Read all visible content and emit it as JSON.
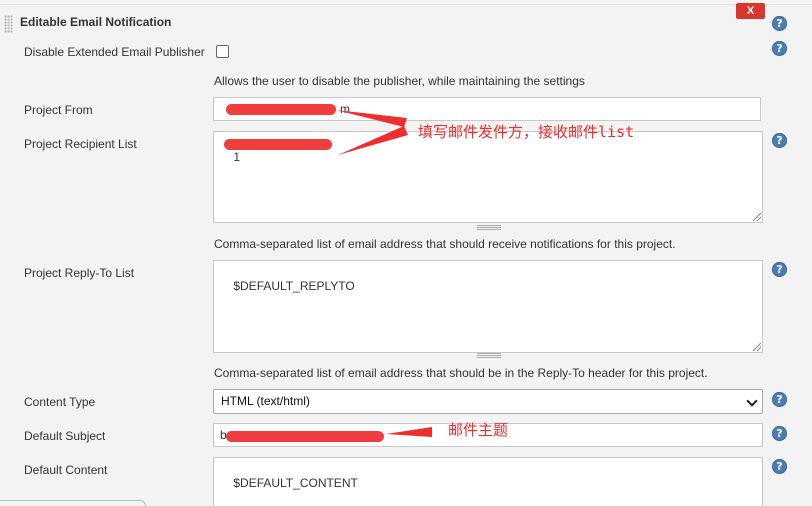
{
  "section": {
    "title": "Editable Email Notification",
    "delete_label": "X"
  },
  "disable_publisher": {
    "label": "Disable Extended Email Publisher",
    "description": "Allows the user to disable the publisher, while maintaining the settings"
  },
  "project_from": {
    "label": "Project From",
    "value": "m"
  },
  "recipient_list": {
    "label": "Project Recipient List",
    "value": "1",
    "description": "Comma-separated list of email address that should receive notifications for this project."
  },
  "reply_to": {
    "label": "Project Reply-To List",
    "value": "$DEFAULT_REPLYTO",
    "description": "Comma-separated list of email address that should be in the Reply-To header for this project."
  },
  "content_type": {
    "label": "Content Type",
    "value": "HTML (text/html)"
  },
  "default_subject": {
    "label": "Default Subject",
    "value": "b"
  },
  "default_content": {
    "label": "Default Content",
    "value": "$DEFAULT_CONTENT"
  },
  "annotations": {
    "sender_recipient": "填写邮件发件方，接收邮件list",
    "subject": "邮件主题"
  },
  "help_symbol": "?",
  "colors": {
    "annotation": "#ee2d2d",
    "help": "#4a7cb5",
    "delete": "#d9362f"
  }
}
